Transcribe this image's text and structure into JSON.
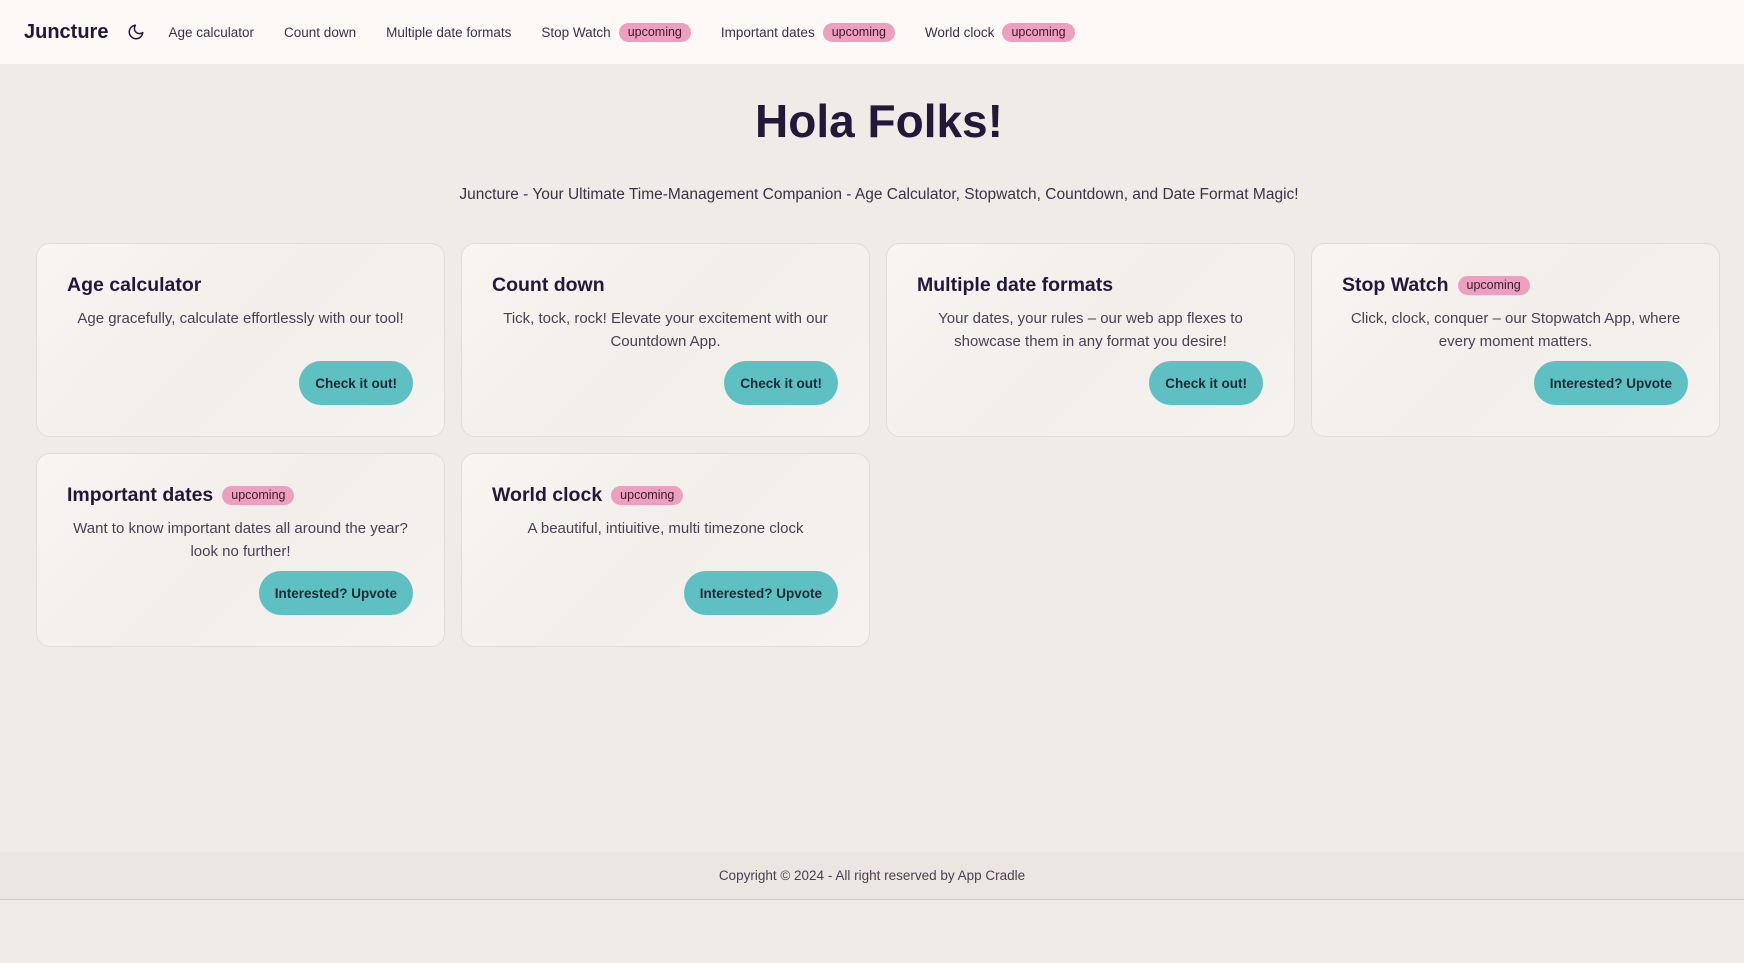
{
  "nav": {
    "brand": "Juncture",
    "theme_icon": "moon-icon",
    "items": [
      {
        "label": "Age calculator",
        "badge": ""
      },
      {
        "label": "Count down",
        "badge": ""
      },
      {
        "label": "Multiple date formats",
        "badge": ""
      },
      {
        "label": "Stop Watch",
        "badge": "upcoming"
      },
      {
        "label": "Important dates",
        "badge": "upcoming"
      },
      {
        "label": "World clock",
        "badge": "upcoming"
      }
    ]
  },
  "hero": {
    "title": "Hola Folks!",
    "subtitle": "Juncture - Your Ultimate Time-Management Companion - Age Calculator, Stopwatch, Countdown, and Date Format Magic!"
  },
  "cards": [
    {
      "title": "Age calculator",
      "badge": "",
      "description": "Age gracefully, calculate effortlessly with our tool!",
      "button": "Check it out!"
    },
    {
      "title": "Count down",
      "badge": "",
      "description": "Tick, tock, rock! Elevate your excitement with our Countdown App.",
      "button": "Check it out!"
    },
    {
      "title": "Multiple date formats",
      "badge": "",
      "description": "Your dates, your rules – our web app flexes to showcase them in any format you desire!",
      "button": "Check it out!"
    },
    {
      "title": "Stop Watch",
      "badge": "upcoming",
      "description": "Click, clock, conquer – our Stopwatch App, where every moment matters.",
      "button": "Interested? Upvote"
    },
    {
      "title": "Important dates",
      "badge": "upcoming",
      "description": "Want to know important dates all around the year? look no further!",
      "button": "Interested? Upvote"
    },
    {
      "title": "World clock",
      "badge": "upcoming",
      "description": "A beautiful, intiuitive, multi timezone clock",
      "button": "Interested? Upvote"
    }
  ],
  "footer": {
    "text": "Copyright © 2024 - All right reserved by App Cradle"
  },
  "colors": {
    "accent": "#5fc0c3",
    "badge": "#ec9fbf",
    "background": "#f0ebe7",
    "navbar": "#fcf9f7",
    "text_dark": "#24183a"
  }
}
